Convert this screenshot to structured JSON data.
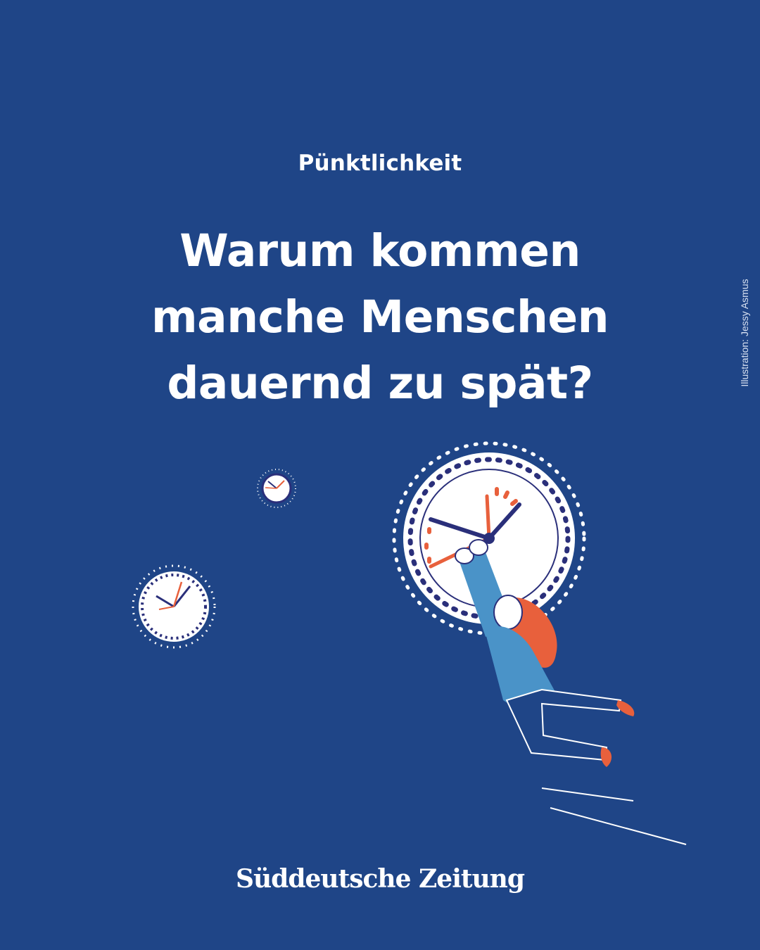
{
  "kicker": "Pünktlichkeit",
  "headline": {
    "line1": "Warum kommen",
    "line2": "manche Menschen",
    "line3": "dauernd zu spät?"
  },
  "credit": "Illustration: Jessy Asmus",
  "brand": "Süddeutsche Zeitung",
  "colors": {
    "background": "#1f4587",
    "text": "#ffffff",
    "accent_red": "#e8603c",
    "clock_navy": "#2a2f7a",
    "shirt_blue": "#4a93c8"
  }
}
